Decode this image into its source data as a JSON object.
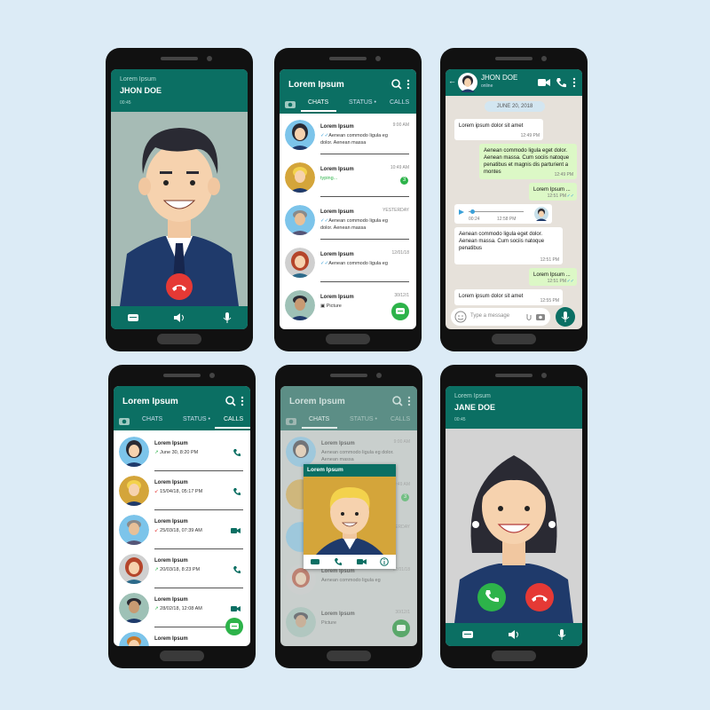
{
  "colors": {
    "teal": "#0b6f63",
    "green": "#2db34a",
    "red": "#e53935",
    "bg": "#dcebf6"
  },
  "call1": {
    "label": "Lorem Ipsum",
    "name": "JHON DOE",
    "time": "00:45"
  },
  "call2": {
    "label": "Lorem Ipsum",
    "name": "JANE DOE",
    "time": "00:45"
  },
  "app": {
    "title": "Lorem Ipsum",
    "tabs": [
      "CHATS",
      "STATUS •",
      "CALLS"
    ]
  },
  "chats": [
    {
      "name": "Lorem Ipsum",
      "msg": "Aenean commodo ligula eg dolor. Aenean massa",
      "time": "9:00 AM"
    },
    {
      "name": "Lorem Ipsum",
      "msg": "typing...",
      "time": "10:49 AM",
      "badge": "3"
    },
    {
      "name": "Lorem Ipsum",
      "msg": "Aenean commodo ligula eg dolor. Aenean massa",
      "time": "YESTERDAY"
    },
    {
      "name": "Lorem Ipsum",
      "msg": "Aenean commodo ligula eg",
      "time": "12/01/18"
    },
    {
      "name": "Lorem Ipsum",
      "msg": "Picture",
      "time": "30/12/1"
    }
  ],
  "calls": [
    {
      "name": "Lorem Ipsum",
      "detail": "June 30, 8:20 PM",
      "type": "phone"
    },
    {
      "name": "Lorem Ipsum",
      "detail": "15/04/18, 05:17 PM",
      "type": "phone"
    },
    {
      "name": "Lorem Ipsum",
      "detail": "25/03/18, 07:39 AM",
      "type": "video"
    },
    {
      "name": "Lorem Ipsum",
      "detail": "20/03/18, 8:23 PM",
      "type": "phone"
    },
    {
      "name": "Lorem Ipsum",
      "detail": "28/02/18, 12:08 AM",
      "type": "video"
    },
    {
      "name": "Lorem Ipsum",
      "detail": "",
      "type": "phone"
    }
  ],
  "conversation": {
    "contact": "JHON DOE",
    "status": "online",
    "date": "JUNE 20, 2018",
    "messages": [
      {
        "dir": "in",
        "text": "Lorem ipsum dolor sit amet",
        "time": "12:49 PM"
      },
      {
        "dir": "out",
        "text": "Aenean commodo ligula eget dolor. Aenean massa. Cum sociis natoque penatibus et magnis dis parturient a montes",
        "time": "12:49 PM"
      },
      {
        "dir": "out",
        "text": "Lorem Ipsum ...",
        "time": "12:51 PM"
      },
      {
        "dir": "voice",
        "start": "00:24",
        "end": "12:58 PM"
      },
      {
        "dir": "in",
        "text": "Aenean commodo ligula eget dolor. Aenean massa. Cum sociis natoque penatibus",
        "time": "12:51 PM"
      },
      {
        "dir": "out",
        "text": "Lorem Ipsum ...",
        "time": "12:51 PM"
      },
      {
        "dir": "in",
        "text": "Lorem ipsum dolor sit amet",
        "time": "12:55 PM"
      }
    ],
    "input_placeholder": "Type a message"
  },
  "popup": {
    "name": "Lorem Ipsum"
  }
}
